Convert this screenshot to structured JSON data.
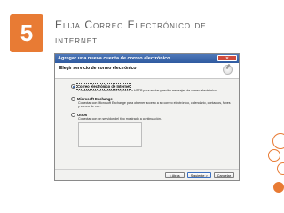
{
  "slide": {
    "number": "5",
    "title_line1": "Elija Correo Electrónico de",
    "title_line2": "internet"
  },
  "dialog": {
    "title": "Agregar una nueva cuenta de correo electrónico",
    "close_label": "✕",
    "header_title": "Elegir servicio de correo electrónico",
    "header_icon": "email-account-icon",
    "options": [
      {
        "label": "Correo electrónico de Internet",
        "description": "Conectar con un servidor POP, IMAP o HTTP para enviar y recibir mensajes de correo electrónico.",
        "selected": true
      },
      {
        "label": "Microsoft Exchange",
        "description": "Conectar con Microsoft Exchange para obtener acceso a su correo electrónico, calendario, contactos, faxes y correo de voz.",
        "selected": false
      },
      {
        "label": "Otros",
        "description": "Conectar con un servidor del tipo mostrado a continuación.",
        "selected": false
      }
    ],
    "buttons": {
      "back": "< Atrás",
      "next": "Siguiente >",
      "cancel": "Cancelar"
    }
  },
  "colors": {
    "accent": "#e87b34",
    "titlebar": "#2f5aa0",
    "title_text": "#5a5a5a"
  }
}
